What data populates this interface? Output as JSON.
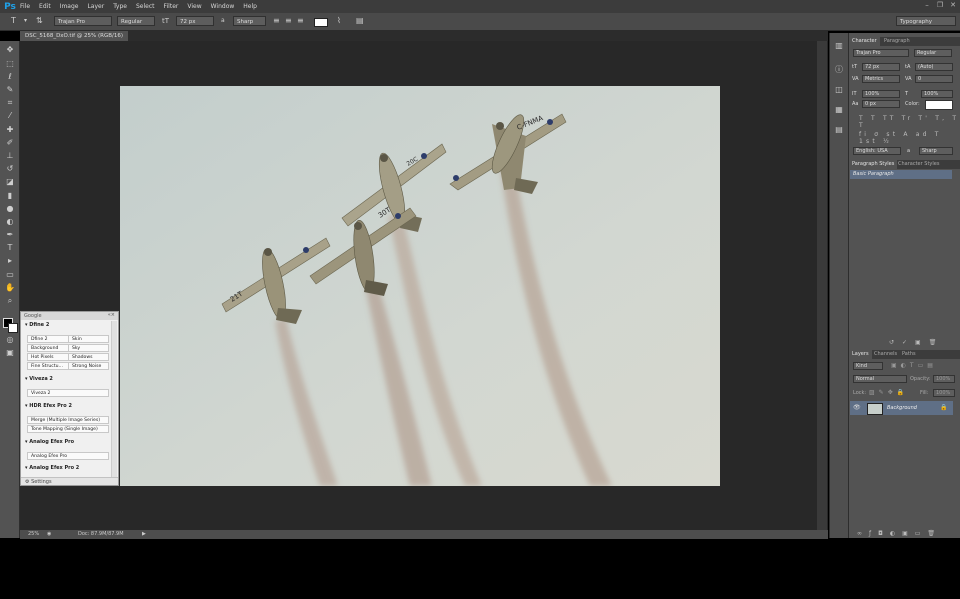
{
  "app": {
    "logo": "Ps"
  },
  "menu": [
    "File",
    "Edit",
    "Image",
    "Layer",
    "Type",
    "Select",
    "Filter",
    "View",
    "Window",
    "Help"
  ],
  "options_bar": {
    "font_family": "Trajan Pro",
    "font_style": "Regular",
    "font_size": "72 px",
    "aa_label": "a",
    "antialias": "Sharp",
    "workspace": "Typography"
  },
  "document": {
    "tab_title": "DSC_5168_DxO.tif @ 25% (RGB/16)"
  },
  "status": {
    "zoom": "25%",
    "doc_size": "Doc: 87.9M/87.9M"
  },
  "character_panel": {
    "tabs": [
      "Character",
      "Paragraph"
    ],
    "font_family": "Trajan Pro",
    "font_style": "Regular",
    "size": "72 px",
    "leading": "(Auto)",
    "kerning": "Metrics",
    "tracking": "0",
    "vscale": "100%",
    "hscale": "100%",
    "baseline": "0 px",
    "color_label": "Color:",
    "language": "English: USA",
    "aa_label": "a",
    "antialias": "Sharp",
    "typo_row1": "T T TT Tr T' T, T T",
    "typo_row2": "fi σ st A ad T 1st ½"
  },
  "styles_panel": {
    "tabs": [
      "Paragraph Styles",
      "Character Styles"
    ],
    "item": "Basic Paragraph"
  },
  "layers_panel": {
    "tabs": [
      "Layers",
      "Channels",
      "Paths"
    ],
    "kind": "Kind",
    "blend_mode": "Normal",
    "opacity_label": "Opacity:",
    "opacity": "100%",
    "lock_label": "Lock:",
    "fill_label": "Fill:",
    "fill": "100%",
    "layer_name": "Background"
  },
  "google_panel": {
    "title": "Google",
    "sections": [
      {
        "name": "Dfine 2",
        "buttons": [
          "Dfine 2",
          "Skin",
          "Background",
          "Sky",
          "Hot Pixels",
          "Shadows",
          "Fine Structu...",
          "Strong Noise"
        ]
      },
      {
        "name": "Viveza 2",
        "buttons": [
          "Viveza 2"
        ]
      },
      {
        "name": "HDR Efex Pro 2",
        "buttons": [
          "Merge (Multiple Image Series)",
          "Tone Mapping (Single Image)"
        ]
      },
      {
        "name": "Analog Efex Pro",
        "buttons": [
          "Analog Efex Pro"
        ]
      },
      {
        "name": "Analog Efex Pro 2",
        "buttons": []
      }
    ],
    "settings": "Settings"
  },
  "photo_text": {
    "plane1": "C-FNMA",
    "plane2": "20C",
    "plane3": "30T",
    "plane4": "21T"
  },
  "colors": {
    "ps_blue": "#1fa1e8",
    "panel_bg": "#535353",
    "canvas_bg": "#282828",
    "sky": "#c9d2cf",
    "selected_style": "#5f6f86"
  }
}
